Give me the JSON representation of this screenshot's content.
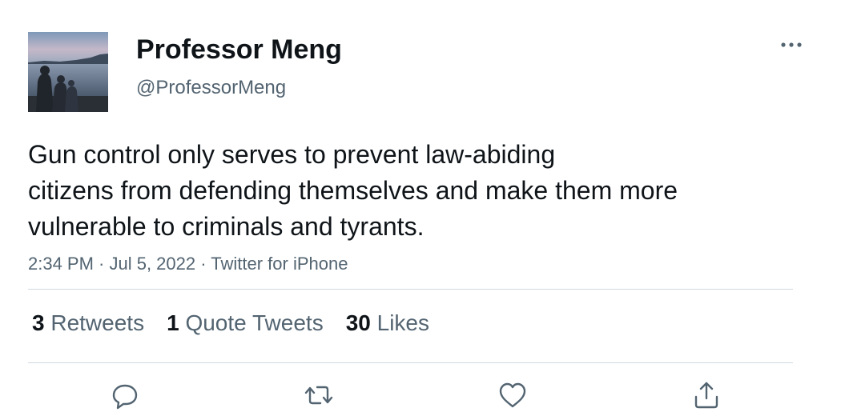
{
  "tweet": {
    "author": {
      "display_name": "Professor Meng",
      "handle": "@ProfessorMeng"
    },
    "text_lines": [
      "Gun control only serves to prevent law-abiding",
      "citizens from defending themselves and make them more",
      "vulnerable to criminals and tyrants."
    ],
    "meta": "2:34 PM · Jul 5, 2022 · Twitter for iPhone",
    "stats": [
      {
        "count": "3",
        "label": "Retweets"
      },
      {
        "count": "1",
        "label": "Quote Tweets"
      },
      {
        "count": "30",
        "label": "Likes"
      }
    ]
  },
  "icons": {
    "more": "more-horizontal-icon",
    "reply": "reply-icon",
    "retweet": "retweet-icon",
    "like": "heart-icon",
    "share": "share-icon"
  },
  "colors": {
    "text": "#0f1419",
    "secondary": "#536471",
    "divider": "#cfd9de"
  }
}
